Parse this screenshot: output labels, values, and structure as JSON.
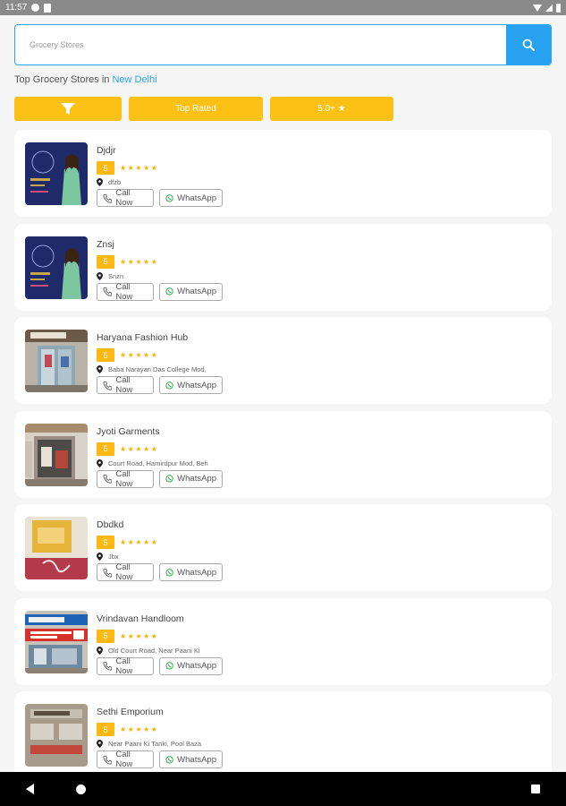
{
  "status_bar": {
    "time": "11:57"
  },
  "search": {
    "placeholder": "Grocery Stores",
    "value": ""
  },
  "heading": {
    "prefix": "Top Grocery Stores in ",
    "city": "New Delhi"
  },
  "filters": {
    "top_rated_label": "Top Rated",
    "rating_label": "5.0+ ★"
  },
  "colors": {
    "accent_blue": "#27a2f0",
    "filter_yellow": "#fdc015",
    "rating_badge": "#fdb813",
    "star": "#f7b500"
  },
  "listings": [
    {
      "name": "Djdjr",
      "rating": "5",
      "stars": "★★★★★",
      "address": "dfzb",
      "call_label": "Call Now",
      "whatsapp_label": "WhatsApp",
      "thumb": "poster-woman"
    },
    {
      "name": "Znsj",
      "rating": "5",
      "stars": "★★★★★",
      "address": "Snzn",
      "call_label": "Call Now",
      "whatsapp_label": "WhatsApp",
      "thumb": "poster-woman"
    },
    {
      "name": "Haryana Fashion Hub",
      "rating": "5",
      "stars": "★★★★★",
      "address": "Baba Narayan Das College Mod,",
      "call_label": "Call Now",
      "whatsapp_label": "WhatsApp",
      "thumb": "storefront-glass"
    },
    {
      "name": "Jyoti Garments",
      "rating": "5",
      "stars": "★★★★★",
      "address": "Court Road, Hamirdpur Mod, Beh",
      "call_label": "Call Now",
      "whatsapp_label": "WhatsApp",
      "thumb": "storefront-door"
    },
    {
      "name": "Dbdkd",
      "rating": "5",
      "stars": "★★★★★",
      "address": "Jbx",
      "call_label": "Call Now",
      "whatsapp_label": "WhatsApp",
      "thumb": "yellow-box"
    },
    {
      "name": "Vrindavan Handloom",
      "rating": "5",
      "stars": "★★★★★",
      "address": "Old Court Road, Near Paani Ki",
      "call_label": "Call Now",
      "whatsapp_label": "WhatsApp",
      "thumb": "shop-signboard"
    },
    {
      "name": "Sethi Emporium",
      "rating": "5",
      "stars": "★★★★★",
      "address": "Near Paani Ki Tanki, Pool Baza",
      "call_label": "Call Now",
      "whatsapp_label": "WhatsApp",
      "thumb": "building-facade"
    }
  ]
}
